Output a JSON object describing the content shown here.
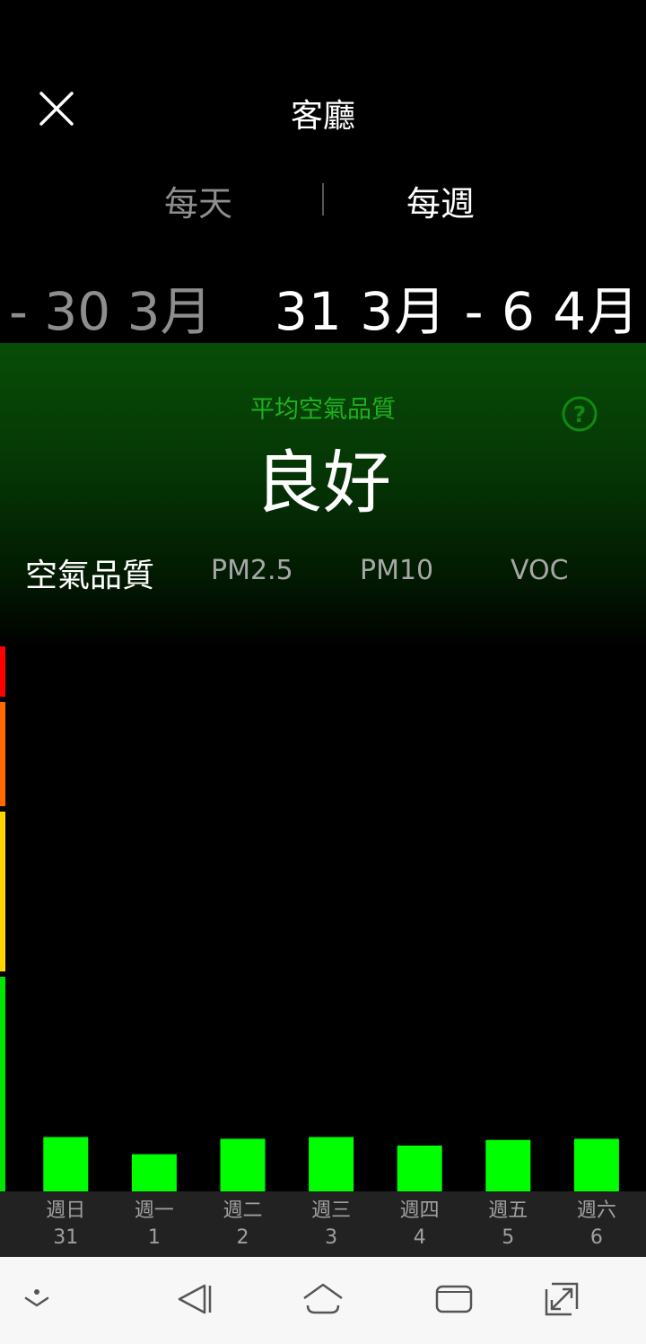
{
  "header": {
    "title": "客廳",
    "close_icon": "close-icon"
  },
  "period_tabs": {
    "daily": "每天",
    "weekly": "每週",
    "selected": "每週"
  },
  "date_range": {
    "previous": "- 30 3月",
    "current": "31 3月 - 6 4月"
  },
  "summary": {
    "label": "平均空氣品質",
    "value": "良好",
    "help_icon": "help-circle-icon"
  },
  "metric_tabs": [
    {
      "label": "空氣品質",
      "selected": true
    },
    {
      "label": "PM2.5",
      "selected": false
    },
    {
      "label": "PM10",
      "selected": false
    },
    {
      "label": "VOC",
      "selected": false
    }
  ],
  "colors": {
    "bar": "#00ff00",
    "scale": [
      "#ff0000",
      "#ff6a00",
      "#ffd400",
      "#00e600"
    ],
    "accent_green": "#1fb01f"
  },
  "chart_data": {
    "type": "bar",
    "categories": [
      {
        "day": "週日",
        "date": "31"
      },
      {
        "day": "週一",
        "date": "1"
      },
      {
        "day": "週二",
        "date": "2"
      },
      {
        "day": "週三",
        "date": "3"
      },
      {
        "day": "週四",
        "date": "4"
      },
      {
        "day": "週五",
        "date": "5"
      },
      {
        "day": "週六",
        "date": "6"
      }
    ],
    "values": [
      9.5,
      6.5,
      9.2,
      9.5,
      8.0,
      9.0,
      9.2
    ],
    "ylim": [
      0,
      100
    ],
    "grid": false
  },
  "navbar": {
    "icons": [
      "chevron-down-dot-icon",
      "back-icon",
      "home-icon",
      "recents-icon",
      "expand-icon"
    ]
  }
}
